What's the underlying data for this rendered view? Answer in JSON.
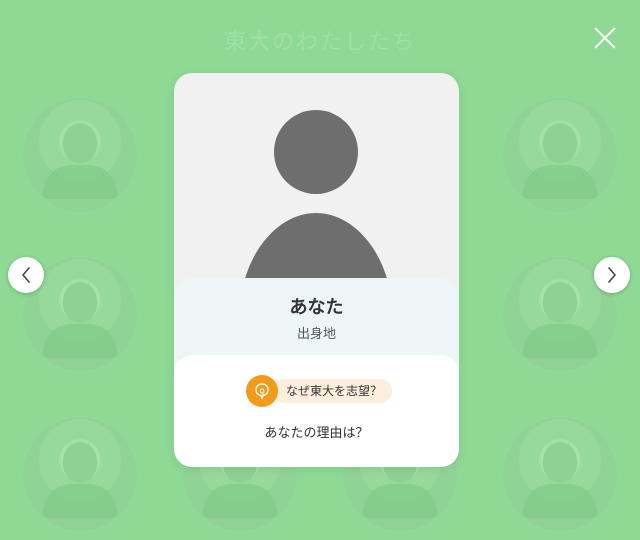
{
  "background": {
    "title": "東大のわたしたち",
    "color": "#8ed994"
  },
  "controls": {
    "close_icon": "close-icon",
    "prev_icon": "chevron-left-icon",
    "next_icon": "chevron-right-icon"
  },
  "card": {
    "name": "あなた",
    "hometown": "出身地",
    "question_label": "なぜ東大を志望？",
    "question_icon": "speech-bubble-q-icon",
    "answer": "あなたの理由は？",
    "accent_color": "#f29b1b"
  }
}
